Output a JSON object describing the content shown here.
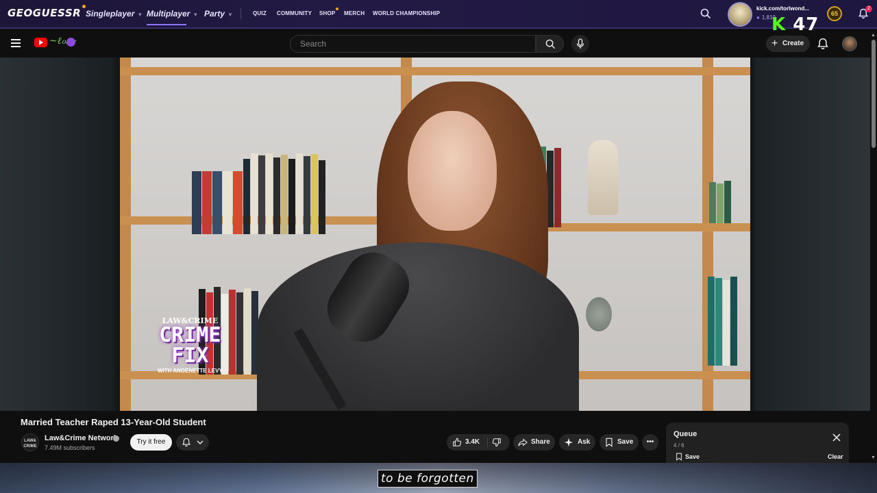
{
  "geoguessr": {
    "logo": "GEOGUESSR",
    "nav": {
      "singleplayer": "Singleplayer",
      "multiplayer": "Multiplayer",
      "party": "Party",
      "quiz": "QUIZ",
      "community": "COMMUNITY",
      "shop": "SHOP",
      "merch": "MERCH",
      "world_championship": "WORLD CHAMPIONSHIP"
    },
    "user": {
      "name": "kick.com/torlwond...",
      "coins": "1,810",
      "level": "65"
    },
    "notifications_count": "2",
    "active_tab": "Multiplayer"
  },
  "kick_overlay": {
    "k": "K",
    "number": "47"
  },
  "youtube": {
    "search": {
      "placeholder": "Search"
    },
    "create_label": "Create",
    "video": {
      "title": "Married Teacher Raped 13-Year-Old Student",
      "overlay_logo": {
        "top": "LAW&CRIME",
        "line1": "CRIME",
        "line2": "FIX",
        "tagline": "WITH ANGENETTE LEVY"
      }
    },
    "channel": {
      "avatar_text": "LAW& CRIME",
      "name": "Law&Crime Network",
      "subscribers": "7.49M subscribers",
      "try_label": "Try it free"
    },
    "actions": {
      "likes": "3.4K",
      "share": "Share",
      "ask": "Ask",
      "save": "Save"
    },
    "queue": {
      "title": "Queue",
      "position": "4 / 6",
      "save": "Save",
      "clear": "Clear"
    }
  },
  "subtitle": "to be forgotten",
  "colors": {
    "geo_bg": "#1d1638",
    "yt_bg": "#0f0f0f",
    "yt_red": "#ff0000",
    "kick_green": "#53fc18",
    "accent_purple": "#8e74ff"
  }
}
